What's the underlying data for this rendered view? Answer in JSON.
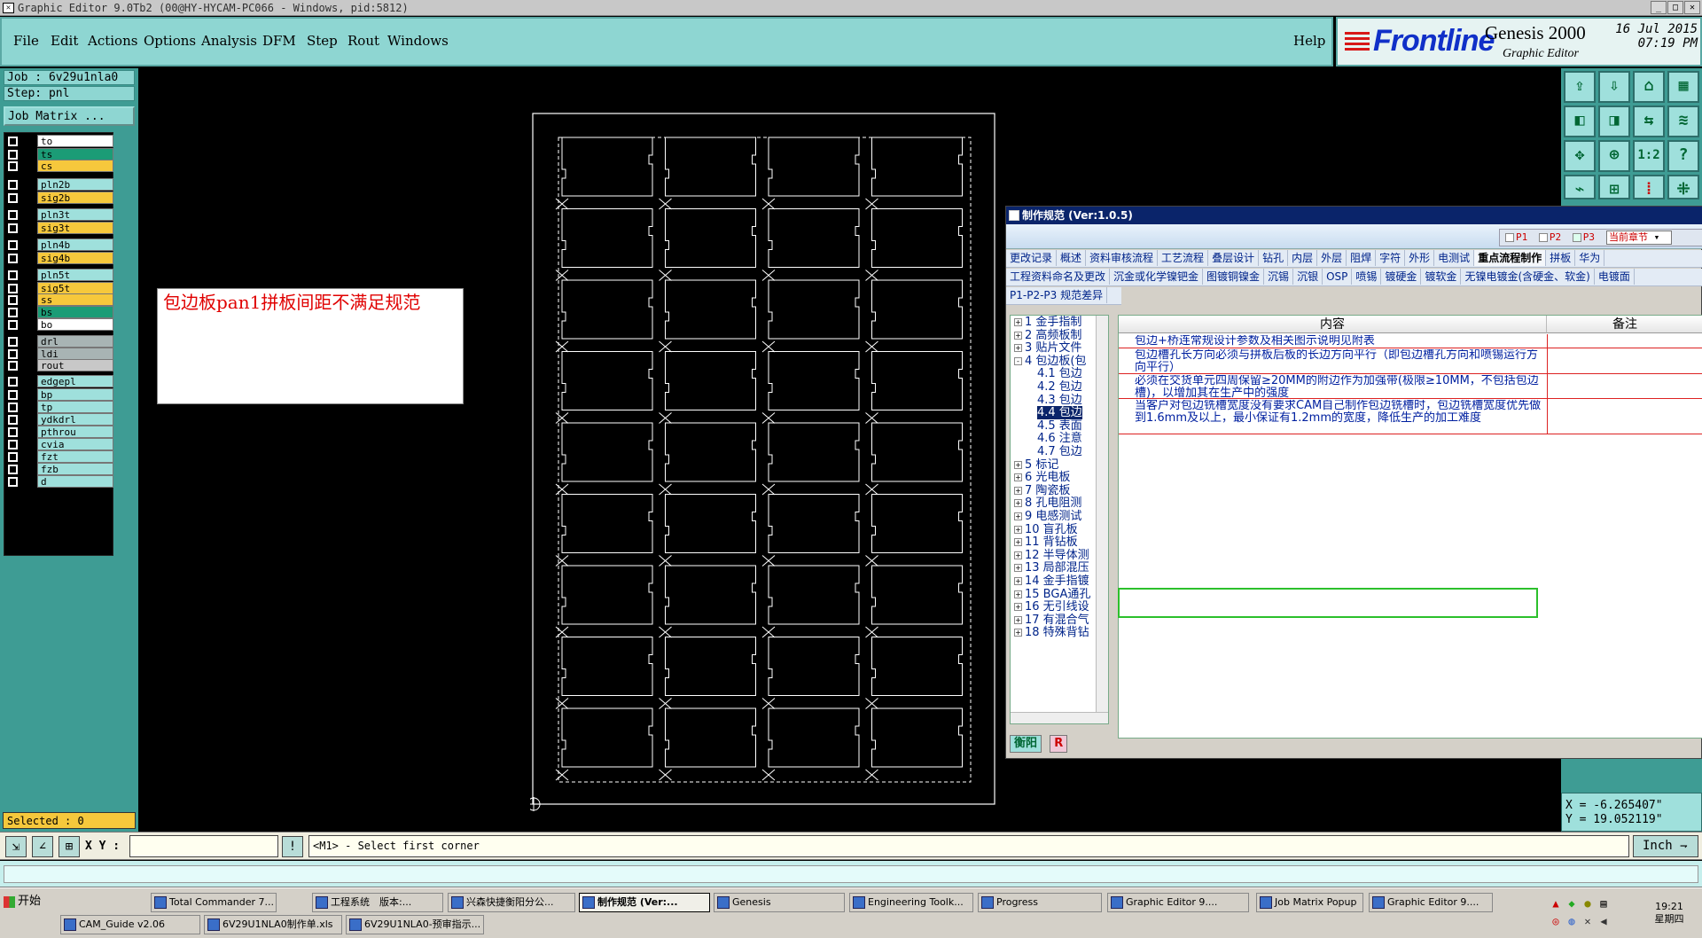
{
  "window": {
    "title": "Graphic Editor 9.0Tb2 (00@HY-HYCAM-PC066 - Windows, pid:5812)"
  },
  "menu": [
    "File",
    "Edit",
    "Actions",
    "Options",
    "Analysis",
    "DFM",
    "Step",
    "Rout",
    "Windows"
  ],
  "help_label": "Help",
  "brand": {
    "logo": "Frontline",
    "product": "Genesis 2000",
    "subtitle": "Graphic Editor",
    "date": "16 Jul 2015",
    "time": "07:19 PM"
  },
  "job": {
    "job_label": "Job : 6v29u1nla0",
    "step_label": "Step: pnl",
    "matrix_button": "Job Matrix ..."
  },
  "layers": [
    {
      "name": "to",
      "color": "#ffffff"
    },
    {
      "name": "ts",
      "color": "#1b9c76"
    },
    {
      "name": "cs",
      "color": "#f6c83c"
    },
    {
      "name": "pln2b",
      "color": "#9fe0dc"
    },
    {
      "name": "sig2b",
      "color": "#f6c83c"
    },
    {
      "name": "pln3t",
      "color": "#9fe0dc"
    },
    {
      "name": "sig3t",
      "color": "#f6c83c"
    },
    {
      "name": "pln4b",
      "color": "#9fe0dc"
    },
    {
      "name": "sig4b",
      "color": "#f6c83c"
    },
    {
      "name": "pln5t",
      "color": "#9fe0dc"
    },
    {
      "name": "sig5t",
      "color": "#f6c83c"
    },
    {
      "name": "ss",
      "color": "#f6c83c"
    },
    {
      "name": "bs",
      "color": "#1b9c76"
    },
    {
      "name": "bo",
      "color": "#ffffff"
    },
    {
      "name": "drl",
      "color": "#a8b4b4"
    },
    {
      "name": "ldi",
      "color": "#a8b4b4"
    },
    {
      "name": "rout",
      "color": "#c8c8c8"
    },
    {
      "name": "edgepl",
      "color": "#9fe0dc"
    },
    {
      "name": "bp",
      "color": "#9fe0dc"
    },
    {
      "name": "tp",
      "color": "#9fe0dc"
    },
    {
      "name": "ydkdrl",
      "color": "#9fe0dc"
    },
    {
      "name": "pthrou",
      "color": "#9fe0dc"
    },
    {
      "name": "cvia",
      "color": "#9fe0dc"
    },
    {
      "name": "fzt",
      "color": "#9fe0dc"
    },
    {
      "name": "fzb",
      "color": "#9fe0dc"
    },
    {
      "name": "d",
      "color": "#9fe0dc"
    }
  ],
  "selected": "Selected : 0",
  "message": "包边板pan1拼板间距不满足规范",
  "panel_grid": {
    "columns": 4,
    "rows": 9
  },
  "coords": {
    "x": "X = -6.265407\"",
    "y": "Y = 19.052119\""
  },
  "command": {
    "xy_label": "X Y :",
    "xy_value": "",
    "prompt": "<M1> - Select first corner",
    "units": "Inch"
  },
  "doc_window": {
    "title": "制作规范 (Ver:1.0.5)",
    "filters": {
      "p1": "P1",
      "p2": "P2",
      "p3": "P3",
      "chapter": "当前章节"
    },
    "tabs_row1": [
      "更改记录",
      "概述",
      "资料审核流程",
      "工艺流程",
      "叠层设计",
      "钻孔",
      "内层",
      "外层",
      "阻焊",
      "字符",
      "外形",
      "电测试",
      "重点流程制作",
      "拼板",
      "华为"
    ],
    "tabs_row2": [
      "工程资料命名及更改",
      "沉金或化学镍钯金",
      "图镀铜镍金",
      "沉锡",
      "沉银",
      "OSP",
      "喷锡",
      "镀硬金",
      "镀软金",
      "无镍电镀金(含硬金、软金)",
      "电镀面"
    ],
    "tabs_row3": [
      "P1-P2-P3 规范差异"
    ],
    "tree": [
      {
        "pm": "+",
        "label": "1 金手指制"
      },
      {
        "pm": "+",
        "label": "2 高频板制"
      },
      {
        "pm": "+",
        "label": "3 贴片文件"
      },
      {
        "pm": "-",
        "label": "4 包边板(包"
      },
      {
        "pm": "",
        "label": "4.1 包边"
      },
      {
        "pm": "",
        "label": "4.2 包边"
      },
      {
        "pm": "",
        "label": "4.3 包边"
      },
      {
        "pm": "",
        "label": "4.4 包边"
      },
      {
        "pm": "",
        "label": "4.5 表面"
      },
      {
        "pm": "",
        "label": "4.6 注意"
      },
      {
        "pm": "",
        "label": "4.7 包边"
      },
      {
        "pm": "+",
        "label": "5 标记"
      },
      {
        "pm": "+",
        "label": "6 光电板"
      },
      {
        "pm": "+",
        "label": "7 陶瓷板"
      },
      {
        "pm": "+",
        "label": "8 孔电阻测"
      },
      {
        "pm": "+",
        "label": "9 电感测试"
      },
      {
        "pm": "+",
        "label": "10 盲孔板"
      },
      {
        "pm": "+",
        "label": "11 背钻板"
      },
      {
        "pm": "+",
        "label": "12 半导体测"
      },
      {
        "pm": "+",
        "label": "13 局部混压"
      },
      {
        "pm": "+",
        "label": "14 金手指镀"
      },
      {
        "pm": "+",
        "label": "15 BGA通孔"
      },
      {
        "pm": "+",
        "label": "16 无引线设"
      },
      {
        "pm": "+",
        "label": "17 有混合气"
      },
      {
        "pm": "+",
        "label": "18 特殊背钻"
      }
    ],
    "columns": [
      "内容",
      "备注"
    ],
    "rows": [
      "包边+桥连常规设计参数及相关图示说明见附表",
      "包边槽孔长方向必须与拼板后板的长边方向平行（即包边槽孔方向和喷锡运行方向平行）",
      "必须在交货单元四周保留≥20MM的附边作为加强带(极限≥10MM，不包括包边槽)，以增加其在生产中的强度",
      "当客户对包边铣槽宽度没有要求CAM自己制作包边铣槽时，包边铣槽宽度优先做到1.6mm及以上，最小保证有1.2mm的宽度，降低生产的加工难度"
    ],
    "bottom_tabs": [
      "衡阳",
      "R"
    ]
  },
  "taskbar": {
    "start": "开始",
    "tasks_row1": [
      "Total Commander 7...",
      "工程系统　版本:...",
      "兴森快捷衡阳分公...",
      "制作规范 (Ver:...",
      "Genesis",
      "Engineering Toolk...",
      "Progress",
      "Graphic Editor 9....",
      "Job Matrix Popup",
      "Graphic Editor 9...."
    ],
    "tasks_row2": [
      "CAM_Guide v2.06",
      "6V29U1NLA0制作单.xls",
      "6V29U1NLA0-预审指示..."
    ],
    "clock_time": "19:21",
    "clock_day": "星期四"
  },
  "colors": {
    "menu_bg": "#8ed6d2",
    "panel_bg": "#3e9c94",
    "message_text": "#e00000",
    "highlight": "#2cc02c"
  }
}
